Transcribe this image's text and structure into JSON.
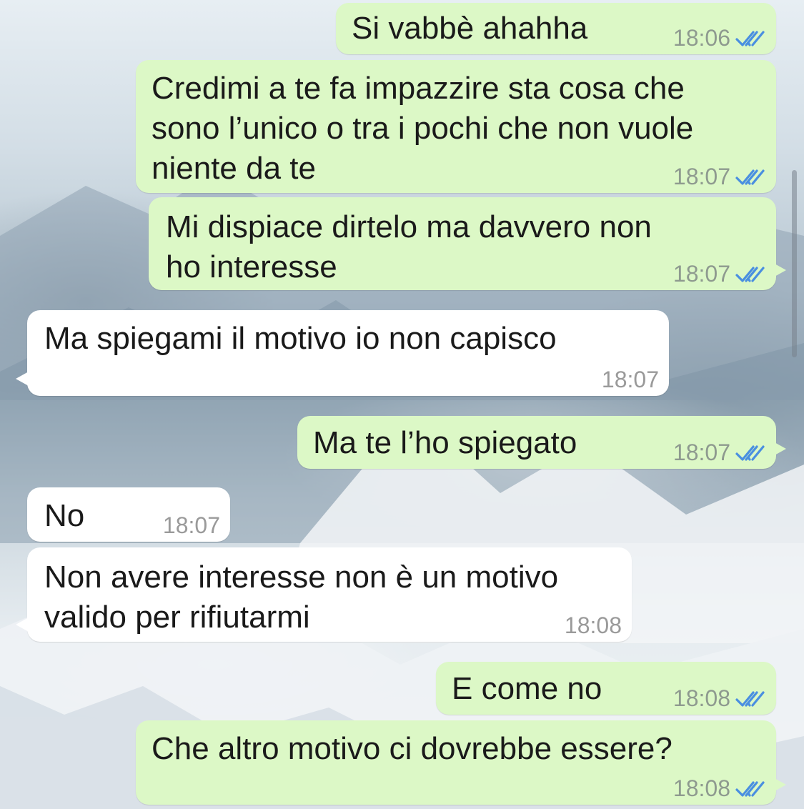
{
  "messages": [
    {
      "direction": "outgoing",
      "text": "Si vabbè ahahha",
      "time": "18:06",
      "status": "read"
    },
    {
      "direction": "outgoing",
      "text": "Credimi a te fa impazzire sta cosa che\nsono l’unico o tra i pochi che non vuole\nniente da te",
      "time": "18:07",
      "status": "read"
    },
    {
      "direction": "outgoing",
      "text": "Mi dispiace dirtelo ma davvero non\nho interesse",
      "time": "18:07",
      "status": "read"
    },
    {
      "direction": "incoming",
      "text": "Ma spiegami il motivo io non capisco",
      "time": "18:07"
    },
    {
      "direction": "outgoing",
      "text": "Ma te l’ho spiegato",
      "time": "18:07",
      "status": "read"
    },
    {
      "direction": "incoming",
      "text": "No",
      "time": "18:07"
    },
    {
      "direction": "incoming",
      "text": "Non avere interesse non è un motivo\nvalido per rifiutarmi",
      "time": "18:08"
    },
    {
      "direction": "outgoing",
      "text": "E come no",
      "time": "18:08",
      "status": "read"
    },
    {
      "direction": "outgoing",
      "text": "Che altro motivo ci dovrebbe essere?",
      "time": "18:08",
      "status": "read"
    }
  ],
  "icons": {
    "read_receipt": "double-check-icon"
  },
  "colors": {
    "outgoing_bubble": "#dcf8c6",
    "incoming_bubble": "#ffffff",
    "read_tick": "#4a8fe0"
  }
}
